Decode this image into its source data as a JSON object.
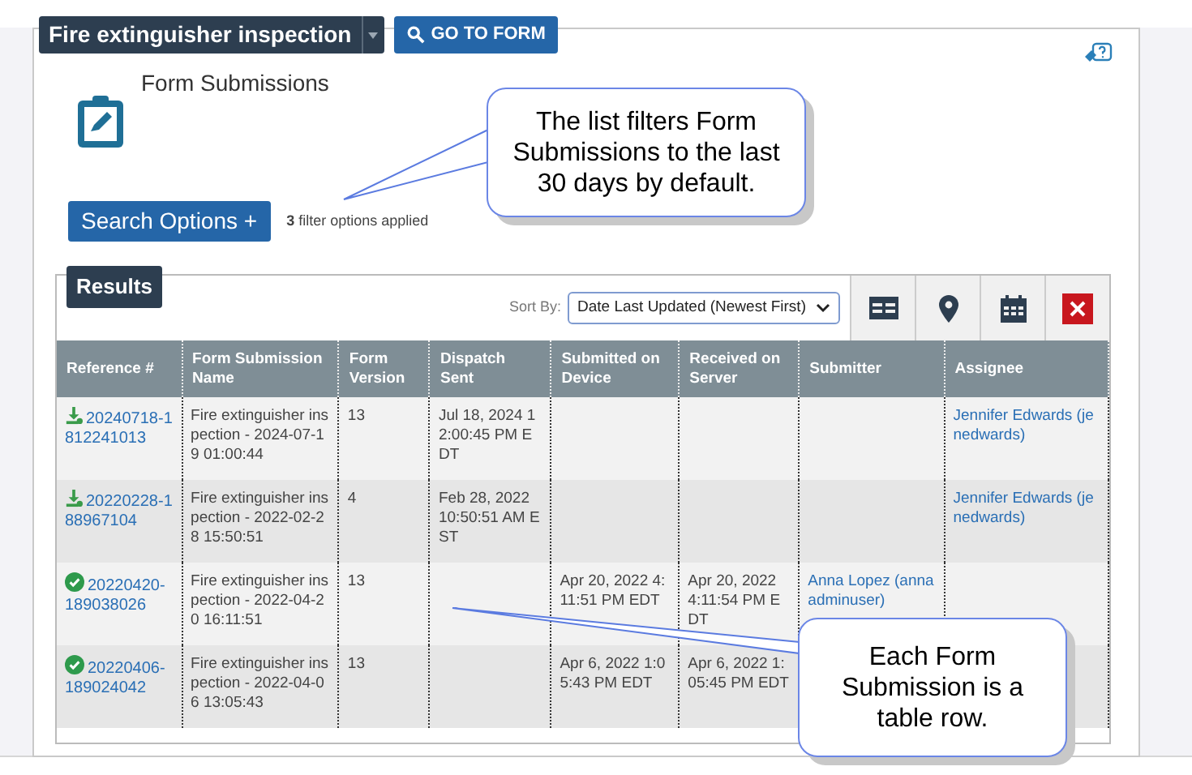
{
  "header": {
    "form_title": "Fire extinguisher inspection",
    "go_button": "GO TO FORM"
  },
  "page": {
    "title": "Form Submissions",
    "search_button": "Search Options +",
    "filter_count": "3",
    "filter_text": "filter options applied"
  },
  "results": {
    "title": "Results",
    "sort_label": "Sort By:",
    "sort_value": "Date Last Updated (Newest First)",
    "columns": [
      "Reference #",
      "Form Submission Name",
      "Form Version",
      "Dispatch Sent",
      "Submitted on Device",
      "Received on Server",
      "Submitter",
      "Assignee"
    ],
    "rows": [
      {
        "kind": "download",
        "reference": "20240718-1812241013",
        "name": "Fire extinguisher inspection - 2024-07-19 01:00:44",
        "version": "13",
        "dispatch": "Jul 18, 2024 12:00:45 PM EDT",
        "assignee": "Jennifer Edwards (jenedwards)"
      },
      {
        "kind": "download",
        "reference": "20220228-188967104",
        "name": "Fire extinguisher inspection - 2022-02-28 15:50:51",
        "version": "4",
        "dispatch": "Feb 28, 2022 10:50:51 AM EST",
        "assignee": "Jennifer Edwards (jenedwards)"
      },
      {
        "kind": "complete",
        "reference": "20220420-189038026",
        "name": "Fire extinguisher inspection - 2022-04-20 16:11:51",
        "version": "13",
        "submitted": "Apr 20, 2022 4:11:51 PM EDT",
        "received": "Apr 20, 2022 4:11:54 PM EDT",
        "submitter": "Anna Lopez (annaadminuser)"
      },
      {
        "kind": "complete",
        "reference": "20220406-189024042",
        "name": "Fire extinguisher inspection - 2022-04-06 13:05:43",
        "version": "13",
        "submitted": "Apr 6, 2022 1:05:43 PM EDT",
        "received": "Apr 6, 2022 1:05:45 PM EDT"
      }
    ]
  },
  "callouts": [
    {
      "text": "The list filters Form Submissions to the last 30 days by default."
    },
    {
      "text": "Each Form Submission is a table row."
    }
  ]
}
